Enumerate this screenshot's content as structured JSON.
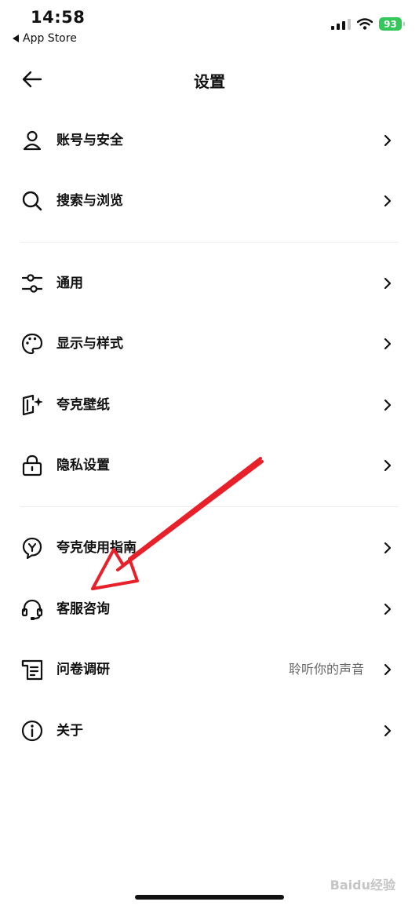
{
  "status_bar": {
    "time": "14:58",
    "back_app": "App Store",
    "battery": "93"
  },
  "nav": {
    "title": "设置",
    "back_icon": "arrow-left-icon"
  },
  "sections": [
    {
      "items": [
        {
          "label": "账号与安全",
          "icon": "user-icon"
        },
        {
          "label": "搜索与浏览",
          "icon": "search-icon"
        }
      ]
    },
    {
      "items": [
        {
          "label": "通用",
          "icon": "sliders-icon"
        },
        {
          "label": "显示与样式",
          "icon": "palette-icon"
        },
        {
          "label": "夸克壁纸",
          "icon": "wallpaper-icon"
        },
        {
          "label": "隐私设置",
          "icon": "lock-icon"
        }
      ]
    },
    {
      "items": [
        {
          "label": "夸克使用指南",
          "icon": "bulb-icon"
        },
        {
          "label": "客服咨询",
          "icon": "headset-icon"
        },
        {
          "label": "问卷调研",
          "icon": "survey-icon",
          "value": "聆听你的声音"
        },
        {
          "label": "关于",
          "icon": "info-icon"
        }
      ]
    }
  ],
  "annotation": {
    "color": "#e8202a"
  },
  "watermark": "Baidu经验"
}
